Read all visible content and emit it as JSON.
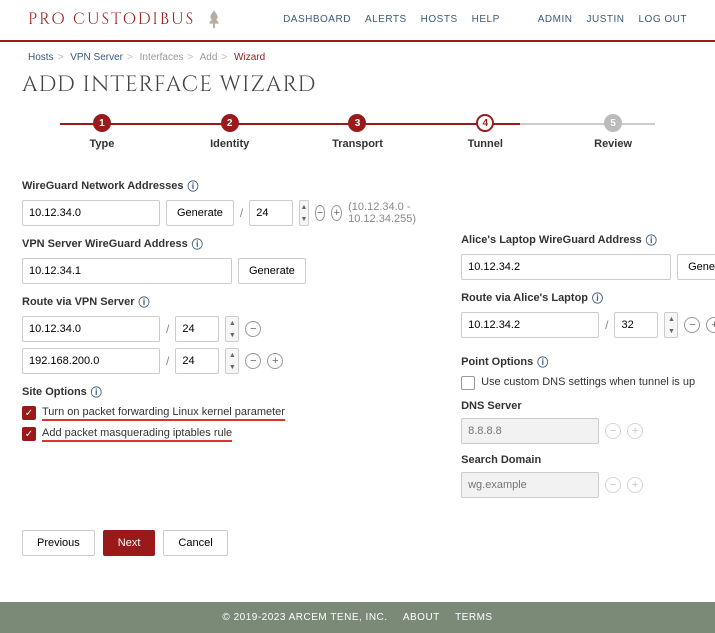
{
  "brand": "PRO CUSTODIBUS",
  "nav": [
    "DASHBOARD",
    "ALERTS",
    "HOSTS",
    "HELP",
    "ADMIN",
    "JUSTIN",
    "LOG OUT"
  ],
  "crumbs": {
    "hosts": "Hosts",
    "vpn": "VPN Server",
    "if": "Interfaces",
    "add": "Add",
    "wiz": "Wizard"
  },
  "title": "ADD INTERFACE WIZARD",
  "steps": {
    "s1": "Type",
    "s2": "Identity",
    "s3": "Transport",
    "s4": "Tunnel",
    "s5": "Review"
  },
  "left": {
    "wg_label": "WireGuard Network Addresses",
    "wg_ip": "10.12.34.0",
    "wg_mask": "24",
    "wg_range": "(10.12.34.0 - 10.12.34.255)",
    "generate": "Generate",
    "vpn_addr_label": "VPN Server WireGuard Address",
    "vpn_addr": "10.12.34.1",
    "route_label": "Route via VPN Server",
    "route1_ip": "10.12.34.0",
    "route1_mask": "24",
    "route2_ip": "192.168.200.0",
    "route2_mask": "24",
    "site_label": "Site Options",
    "opt1": "Turn on packet forwarding Linux kernel parameter",
    "opt2": "Add packet masquerading iptables rule"
  },
  "right": {
    "alice_label": "Alice's Laptop WireGuard Address",
    "alice_ip": "10.12.34.2",
    "generate": "Generate",
    "route_label": "Route via Alice's Laptop",
    "route_ip": "10.12.34.2",
    "route_mask": "32",
    "pt_label": "Point Options",
    "pt_opt": "Use custom DNS settings when tunnel is up",
    "dns_label": "DNS Server",
    "dns_ph": "8.8.8.8",
    "sd_label": "Search Domain",
    "sd_ph": "wg.example"
  },
  "buttons": {
    "prev": "Previous",
    "next": "Next",
    "cancel": "Cancel"
  },
  "footer": {
    "copy": "© 2019-2023  ARCEM TENE, INC.",
    "about": "ABOUT",
    "terms": "TERMS"
  }
}
